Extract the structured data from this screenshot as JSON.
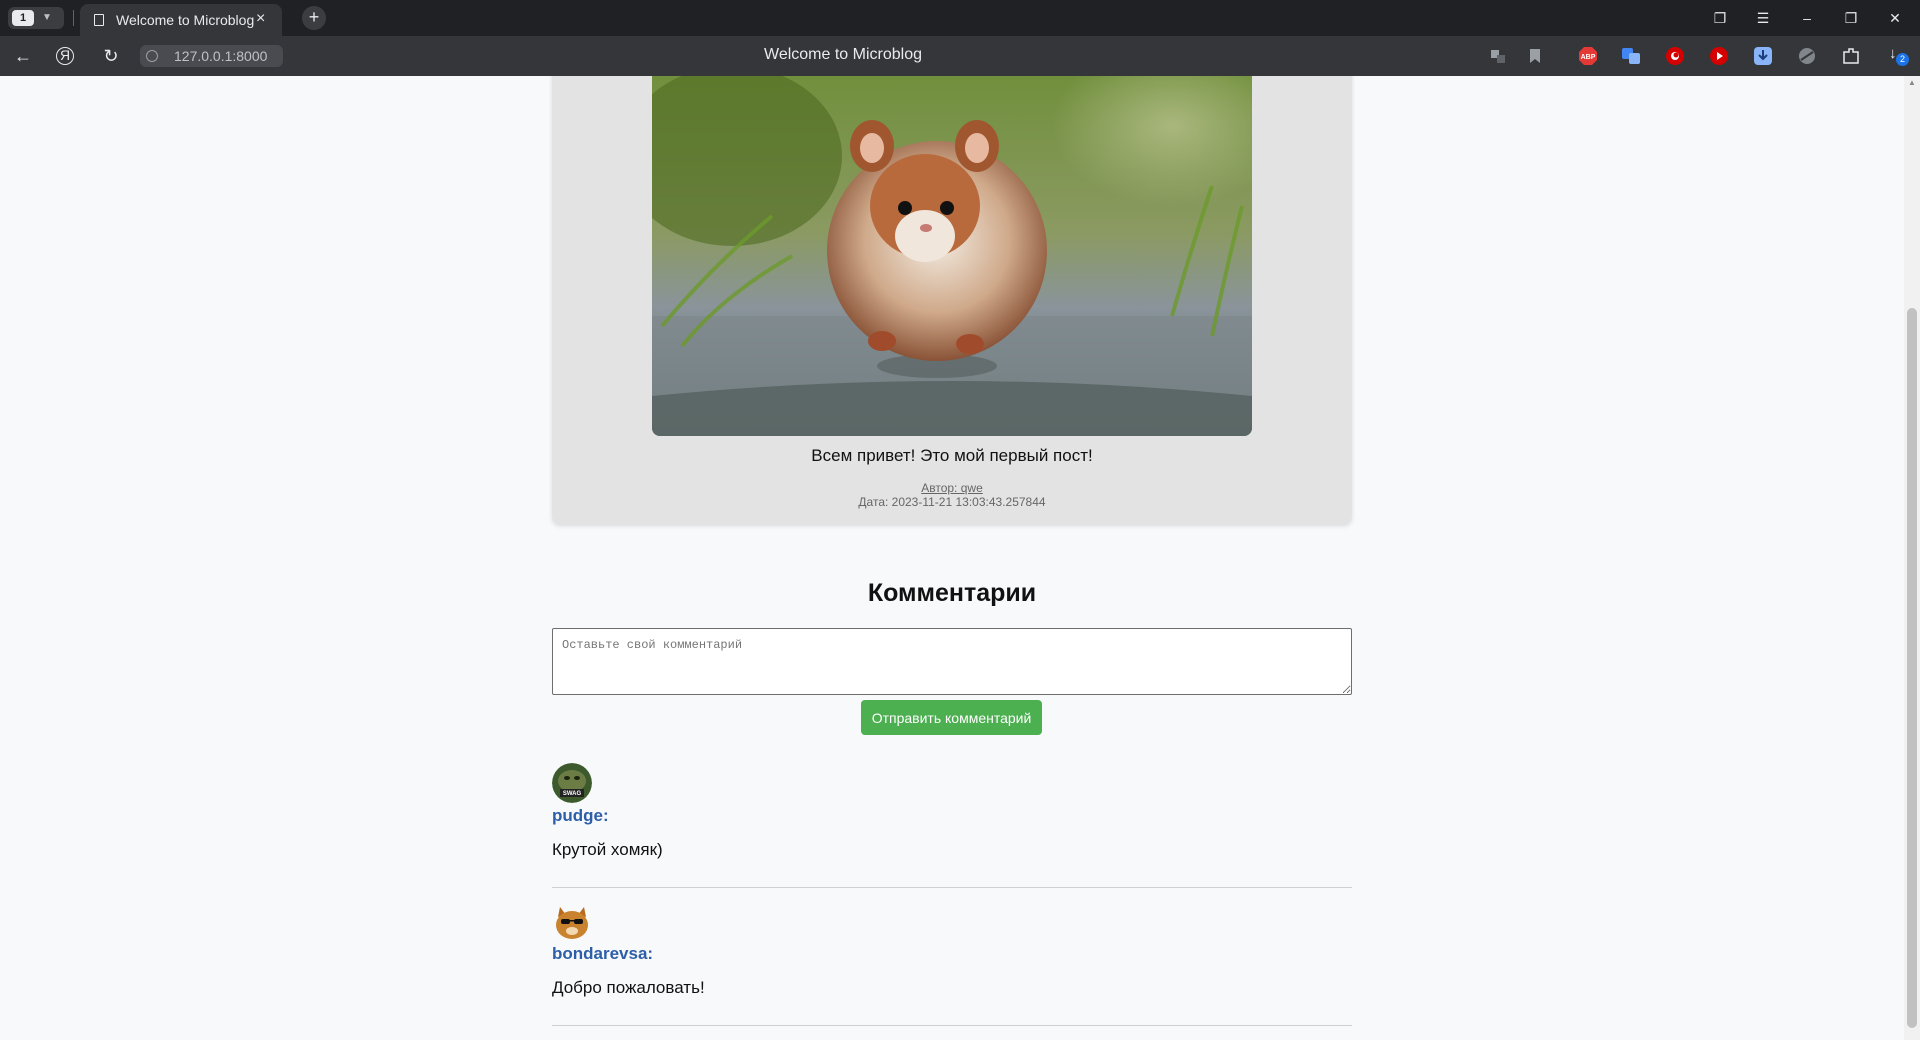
{
  "browser": {
    "tab_count": "1",
    "tab_title": "Welcome to Microblog",
    "url": "127.0.0.1:8000",
    "page_title": "Welcome to Microblog",
    "extension_badge": "2"
  },
  "post": {
    "text": "Всем привет! Это мой первый пост!",
    "author": "Автор: qwe",
    "date": "Дата: 2023-11-21 13:03:43.257844"
  },
  "comments_section": {
    "heading": "Комментарии",
    "placeholder": "Оставьте свой комментарий",
    "submit_label": "Отправить комментарий"
  },
  "comments": [
    {
      "user": "pudge:",
      "text": "Крутой хомяк)",
      "avatar_badge": "SWAG"
    },
    {
      "user": "bondarevsa:",
      "text": "Добро пожаловать!"
    }
  ],
  "colors": {
    "accent_green": "#4caf50",
    "username_blue": "#2d5ea8",
    "card_bg": "#e3e3e3"
  }
}
